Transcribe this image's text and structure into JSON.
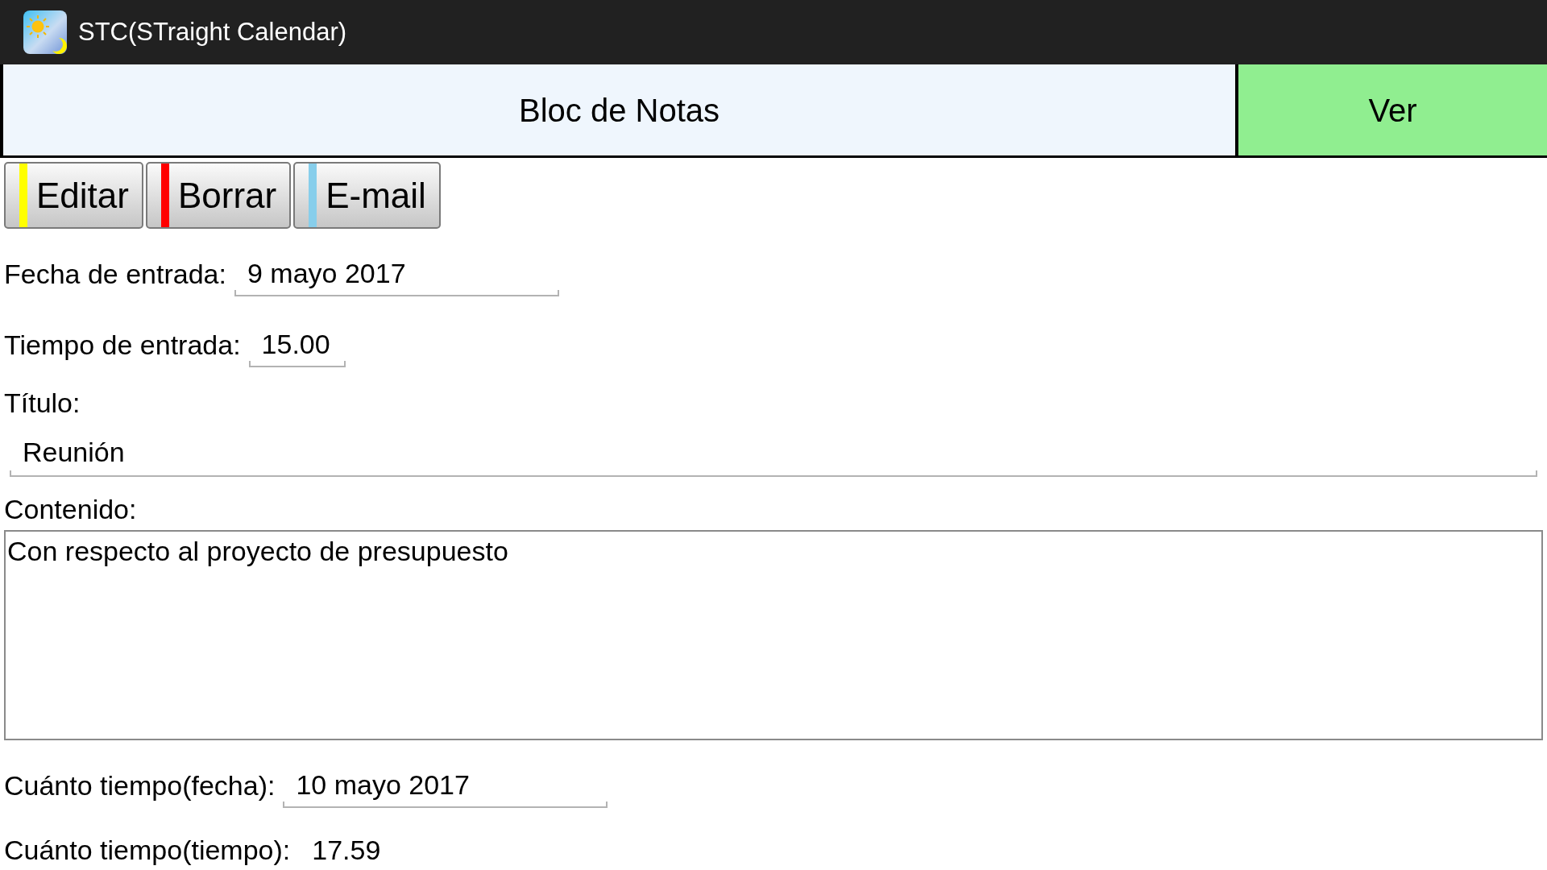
{
  "app_bar": {
    "title": "STC(STraight Calendar)"
  },
  "header": {
    "title": "Bloc de Notas",
    "view_button": "Ver"
  },
  "actions": [
    {
      "label": "Editar",
      "color": "#ffff00"
    },
    {
      "label": "Borrar",
      "color": "#ff0000"
    },
    {
      "label": "E-mail",
      "color": "#87ceeb"
    }
  ],
  "fields": [
    {
      "kind": "date",
      "label": "Fecha de entrada:",
      "value": "9 mayo 2017"
    },
    {
      "kind": "time",
      "label": "Tiempo de entrada:",
      "value": "15.00"
    },
    {
      "kind": "line",
      "label": "Título:",
      "value": "Reunión"
    },
    {
      "kind": "area",
      "label": "Contenido:",
      "value": "Con respecto al proyecto de presupuesto"
    },
    {
      "kind": "date",
      "label": "Cuánto tiempo(fecha):",
      "value": "10 mayo 2017"
    },
    {
      "kind": "text",
      "label": "Cuánto tiempo(tiempo):",
      "value": "17.59"
    }
  ]
}
